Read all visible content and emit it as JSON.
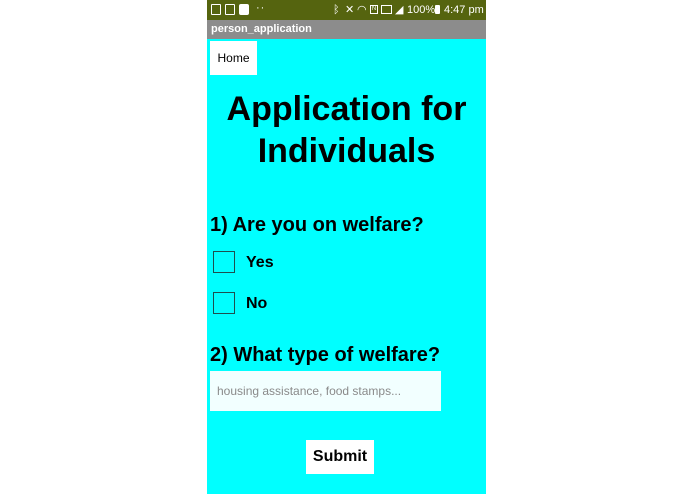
{
  "status_bar": {
    "dots": "··",
    "battery_pct": "100%",
    "time": "4:47 pm",
    "icons": [
      "image-icon",
      "gallery-icon",
      "shield-icon",
      "bluetooth-icon",
      "mute-icon",
      "wifi-icon",
      "nfc-icon",
      "lte-icon",
      "signal-icon",
      "battery-icon"
    ]
  },
  "app": {
    "title": "person_application",
    "home_label": "Home"
  },
  "form": {
    "heading": "Application for Individuals",
    "q1": "1) Are you on welfare?",
    "options": [
      {
        "label": "Yes",
        "checked": false
      },
      {
        "label": "No",
        "checked": false
      }
    ],
    "q2": "2) What type of welfare?",
    "input_value": "",
    "input_placeholder": "housing assistance, food stamps...",
    "submit_label": "Submit"
  },
  "colors": {
    "screen_bg": "#00ffff",
    "status_bar": "#55640f",
    "title_bar": "#8c8c8c",
    "input_bg": "#f2ffff"
  }
}
